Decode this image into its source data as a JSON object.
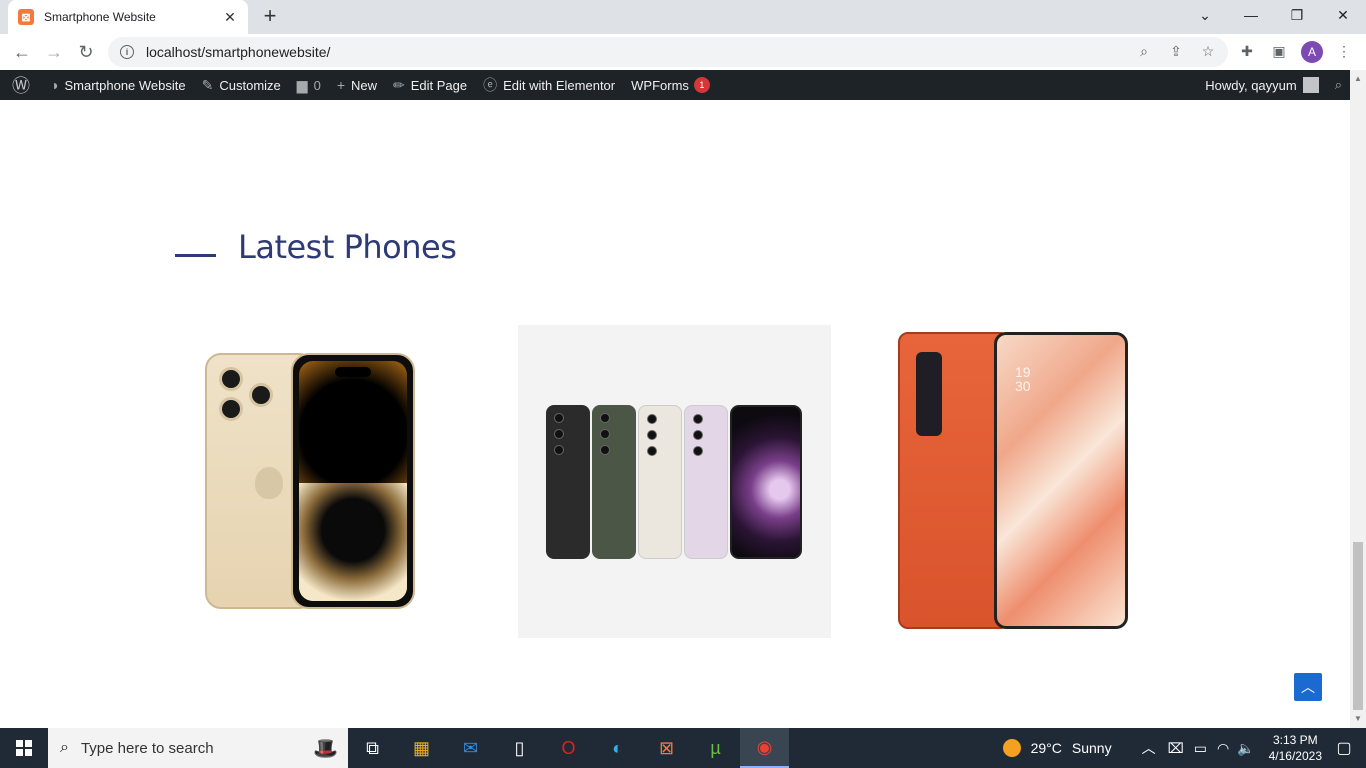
{
  "browser": {
    "tab_title": "Smartphone Website",
    "url": "localhost/smartphonewebsite/",
    "profile_initial": "A"
  },
  "adminbar": {
    "site_name": "Smartphone Website",
    "customize": "Customize",
    "comments_count": "0",
    "new": "New",
    "edit_page": "Edit Page",
    "edit_elementor": "Edit with Elementor",
    "wpforms": "WPForms",
    "wpforms_badge": "1",
    "howdy": "Howdy, qayyum"
  },
  "page": {
    "section_title": "Latest Phones",
    "accent_color": "#2e3a75",
    "products": [
      {
        "name": "iPhone gold",
        "image": "iphone-image"
      },
      {
        "name": "Samsung Galaxy lineup",
        "image": "samsung-image"
      },
      {
        "name": "Oppo orange",
        "image": "oppo-image"
      }
    ]
  },
  "taskbar": {
    "search_placeholder": "Type here to search",
    "weather_temp": "29°C",
    "weather_text": "Sunny",
    "time": "3:13 PM",
    "date": "4/16/2023"
  }
}
